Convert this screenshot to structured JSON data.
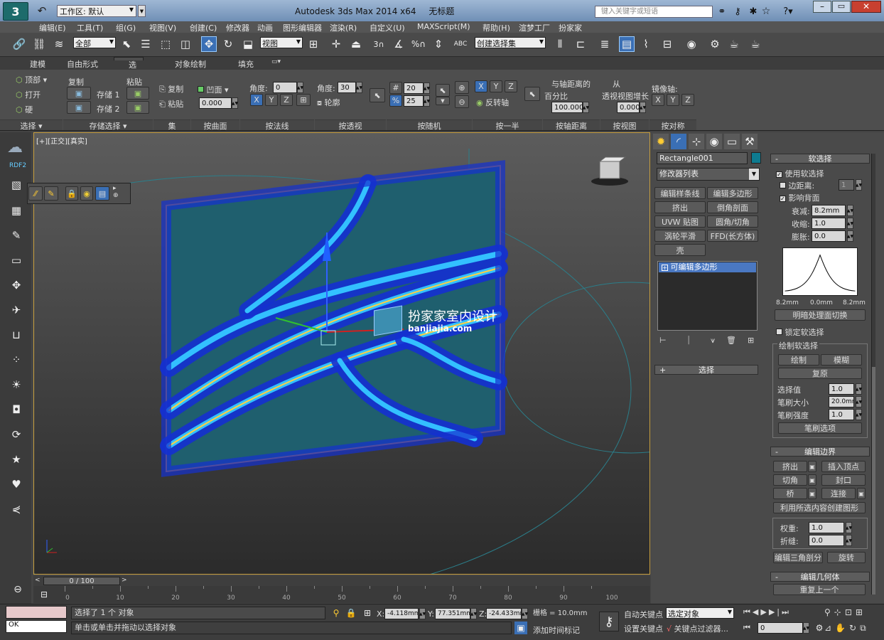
{
  "titlebar": {
    "workspace": "工作区: 默认",
    "app_title": "Autodesk 3ds Max  2014 x64",
    "doc_title": "无标题",
    "search_placeholder": "键入关键字或短语"
  },
  "menu": [
    "编辑(E)",
    "工具(T)",
    "组(G)",
    "视图(V)",
    "创建(C)",
    "修改器",
    "动画",
    "图形编辑器",
    "渲染(R)",
    "自定义(U)",
    "MAXScript(M)",
    "帮助(H)",
    "渲梦工厂",
    "扮家家"
  ],
  "toolbar": {
    "filter_value": "全部",
    "refcoord_value": "视图",
    "selset_value": "创建选择集"
  },
  "ribbon_tabs": [
    "建模",
    "自由形式",
    "选择",
    "对象绘制",
    "填充"
  ],
  "ribbon": {
    "select_items": [
      "顶部",
      "打开",
      "硬"
    ],
    "copy_label": "复制",
    "paste_label": "粘贴",
    "store1": "存储 1",
    "store2": "存储 2",
    "set_copy": "复制",
    "set_paste": "粘贴",
    "concave": "凹面",
    "concave_val": "0.000",
    "angle_label": "角度:",
    "angle_val": "0",
    "angle2_val": "30",
    "outline_label": "轮廓",
    "rand_val1": "20",
    "rand_val2": "25",
    "flip_axis": "反转轴",
    "dist_label1": "与轴距离的",
    "dist_label2": "百分比",
    "dist_val": "100.000",
    "persp1": "从",
    "persp2": "透视视图增长",
    "persp_val": "0.000",
    "mirror_axis": "镜像轴:",
    "panels": [
      "选择",
      "存储选择",
      "集",
      "按曲面",
      "按法线",
      "按透视",
      "按随机",
      "按一半",
      "按轴距离",
      "按视图",
      "按对称"
    ]
  },
  "viewport": {
    "label": "[+][正交][真实]",
    "watermark_title": "扮家家室内设计",
    "watermark_url": "banjiajia.com"
  },
  "leftbar": {
    "label": "RDF2"
  },
  "cmdpanel": {
    "object_name": "Rectangle001",
    "modifier_list": "修改器列表",
    "mod_buttons": [
      "编辑样条线",
      "编辑多边形",
      "挤出",
      "倒角剖面",
      "UVW 贴图",
      "圆角/切角",
      "涡轮平滑",
      "FFD(长方体)",
      "壳"
    ],
    "stack_item": "可编辑多边形",
    "selection_rollout": "选择",
    "soft": {
      "title": "软选择",
      "use_soft": "使用软选择",
      "edge_dist": "边距离:",
      "edge_dist_val": "1",
      "affect_back": "影响背面",
      "falloff": "衰减:",
      "falloff_val": "8.2mm",
      "pinch": "收缩:",
      "pinch_val": "1.0",
      "bubble": "膨胀:",
      "bubble_val": "0.0",
      "curve_left": "8.2mm",
      "curve_mid": "0.0mm",
      "curve_right": "8.2mm",
      "shaded_toggle": "明暗处理面切换",
      "lock": "锁定软选择",
      "paint_group": "绘制软选择",
      "paint": "绘制",
      "blur": "模糊",
      "revert": "复原",
      "sel_value": "选择值",
      "sel_value_val": "1.0",
      "brush_size": "笔刷大小",
      "brush_size_val": "20.0mm",
      "brush_strength": "笔刷强度",
      "brush_strength_val": "1.0",
      "brush_opts": "笔刷选项"
    },
    "edit_border": {
      "title": "编辑边界",
      "extrude": "挤出",
      "insert_vertex": "插入顶点",
      "chamfer": "切角",
      "cap": "封口",
      "bridge": "桥",
      "connect": "连接",
      "create_shape": "利用所选内容创建图形",
      "weight": "权重:",
      "weight_val": "1.0",
      "crease": "折缝:",
      "crease_val": "0.0",
      "edit_tri": "编辑三角剖分",
      "turn": "旋转"
    },
    "edit_geom": {
      "title": "编辑几何体",
      "repeat_last": "重复上一个"
    }
  },
  "timeline": {
    "frame": "0 / 100",
    "ticks": [
      "0",
      "10",
      "20",
      "30",
      "40",
      "50",
      "60",
      "70",
      "80",
      "90",
      "100"
    ]
  },
  "status": {
    "ok": "OK",
    "selected": "选择了 1 个 对象",
    "hint": "单击或单击并拖动以选择对象",
    "x": "-4.118mm",
    "y": "77.351mm",
    "z": "-24.433mm",
    "grid": "栅格 = 10.0mm",
    "add_time_tag": "添加时间标记",
    "auto_key": "自动关键点",
    "set_key": "设置关键点",
    "key_mode": "选定对象",
    "key_filters": "关键点过滤器...",
    "frame_val": "0"
  }
}
